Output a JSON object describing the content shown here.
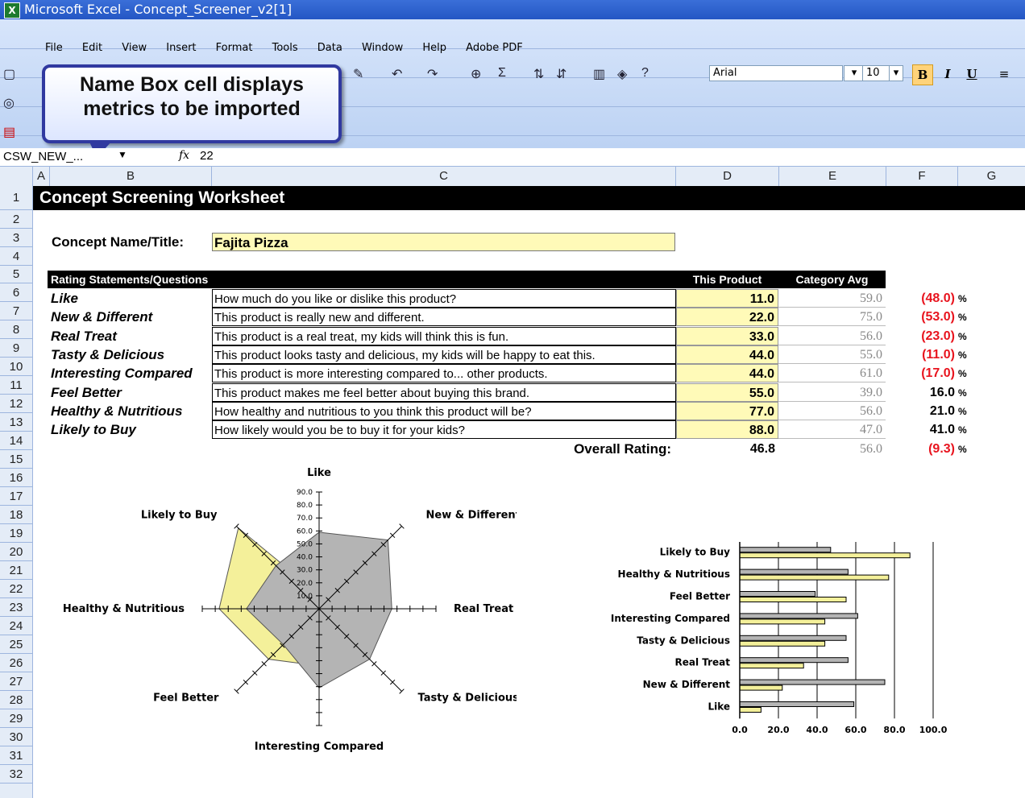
{
  "window": {
    "title": "Microsoft Excel - Concept_Screener_v2[1]"
  },
  "menu": [
    "File",
    "Edit",
    "View",
    "Insert",
    "Format",
    "Tools",
    "Data",
    "Window",
    "Help",
    "Adobe PDF"
  ],
  "toolbar": {
    "font_name": "Arial",
    "font_size": "10",
    "bold": "B",
    "italic": "I",
    "underline": "U"
  },
  "callout": {
    "line1": "Name Box cell displays",
    "line2": "metrics to be imported"
  },
  "formula_bar": {
    "name_box": "CSW_NEW_...",
    "fx_symbol": "fx",
    "value": "22"
  },
  "columns": [
    "A",
    "B",
    "C",
    "D",
    "E",
    "F",
    "G"
  ],
  "rows": [
    "1",
    "2",
    "3",
    "4",
    "5",
    "6",
    "7",
    "8",
    "9",
    "10",
    "11",
    "12",
    "13",
    "14",
    "15",
    "16",
    "17",
    "18",
    "19",
    "20",
    "21",
    "22",
    "23",
    "24",
    "25",
    "26",
    "27",
    "28",
    "29",
    "30",
    "31",
    "32"
  ],
  "sheet": {
    "heading": "Concept Screening Worksheet",
    "concept_label": "Concept Name/Title:",
    "concept_value": "Fajita Pizza",
    "table_header": {
      "statements": "Rating Statements/Questions",
      "product": "This Product",
      "category": "Category Avg"
    },
    "ratings": [
      {
        "label": "Like",
        "statement": "How much do you like or dislike this product?",
        "product": "11.0",
        "category": "59.0",
        "diff": "(48.0)",
        "neg": true,
        "pct": "%"
      },
      {
        "label": "New & Different",
        "statement": "This product is really new and different.",
        "product": "22.0",
        "category": "75.0",
        "diff": "(53.0)",
        "neg": true,
        "pct": "%"
      },
      {
        "label": "Real Treat",
        "statement": "This product is a real treat, my kids will think this is fun.",
        "product": "33.0",
        "category": "56.0",
        "diff": "(23.0)",
        "neg": true,
        "pct": "%"
      },
      {
        "label": "Tasty & Delicious",
        "statement": "This product looks tasty and delicious, my kids will be happy to eat this.",
        "product": "44.0",
        "category": "55.0",
        "diff": "(11.0)",
        "neg": true,
        "pct": "%"
      },
      {
        "label": "Interesting Compared",
        "statement": "This product is more interesting compared to... other products.",
        "product": "44.0",
        "category": "61.0",
        "diff": "(17.0)",
        "neg": true,
        "pct": "%"
      },
      {
        "label": "Feel Better",
        "statement": "This product makes me feel better about buying this brand.",
        "product": "55.0",
        "category": "39.0",
        "diff": "16.0",
        "neg": false,
        "pct": "%"
      },
      {
        "label": "Healthy & Nutritious",
        "statement": "How healthy and nutritious to you think this product will be?",
        "product": "77.0",
        "category": "56.0",
        "diff": "21.0",
        "neg": false,
        "pct": "%"
      },
      {
        "label": "Likely to Buy",
        "statement": "How likely would you be to buy it for your kids?",
        "product": "88.0",
        "category": "47.0",
        "diff": "41.0",
        "neg": false,
        "pct": "%"
      }
    ],
    "overall": {
      "label": "Overall Rating:",
      "product": "46.8",
      "category": "56.0",
      "diff": "(9.3)",
      "pct": "%"
    }
  },
  "colors": {
    "product_fill": "#fffab8",
    "category_fill": "#b4b4b4",
    "negative": "#e8141e",
    "header_bg": "#000000"
  },
  "chart_data": [
    {
      "type": "radar",
      "categories": [
        "Like",
        "New & Different",
        "Real Treat",
        "Tasty & Delicious",
        "Interesting Compared",
        "Feel Better",
        "Healthy & Nutritious",
        "Likely to Buy"
      ],
      "series": [
        {
          "values": [
            11,
            22,
            33,
            44,
            44,
            55,
            77,
            88
          ],
          "color": "#f4f09a"
        },
        {
          "values": [
            59,
            75,
            56,
            55,
            61,
            39,
            56,
            47
          ],
          "color": "#b4b4b4"
        }
      ],
      "ylim": [
        0,
        90
      ],
      "tick_labels": [
        "10.0",
        "20.0",
        "30.0",
        "40.0",
        "50.0",
        "60.0",
        "70.0",
        "80.0",
        "90.0"
      ]
    },
    {
      "type": "bar",
      "orientation": "horizontal",
      "categories": [
        "Likely to Buy",
        "Healthy & Nutritious",
        "Feel Better",
        "Interesting Compared",
        "Tasty & Delicious",
        "Real Treat",
        "New & Different",
        "Like"
      ],
      "series": [
        {
          "values": [
            47,
            56,
            39,
            61,
            55,
            56,
            75,
            59
          ],
          "color": "#b4b4b4"
        },
        {
          "values": [
            88,
            77,
            55,
            44,
            44,
            33,
            22,
            11
          ],
          "color": "#f4f09a"
        }
      ],
      "xlim": [
        0,
        100
      ],
      "tick_labels": [
        "0.0",
        "20.0",
        "40.0",
        "60.0",
        "80.0",
        "100.0"
      ]
    }
  ]
}
